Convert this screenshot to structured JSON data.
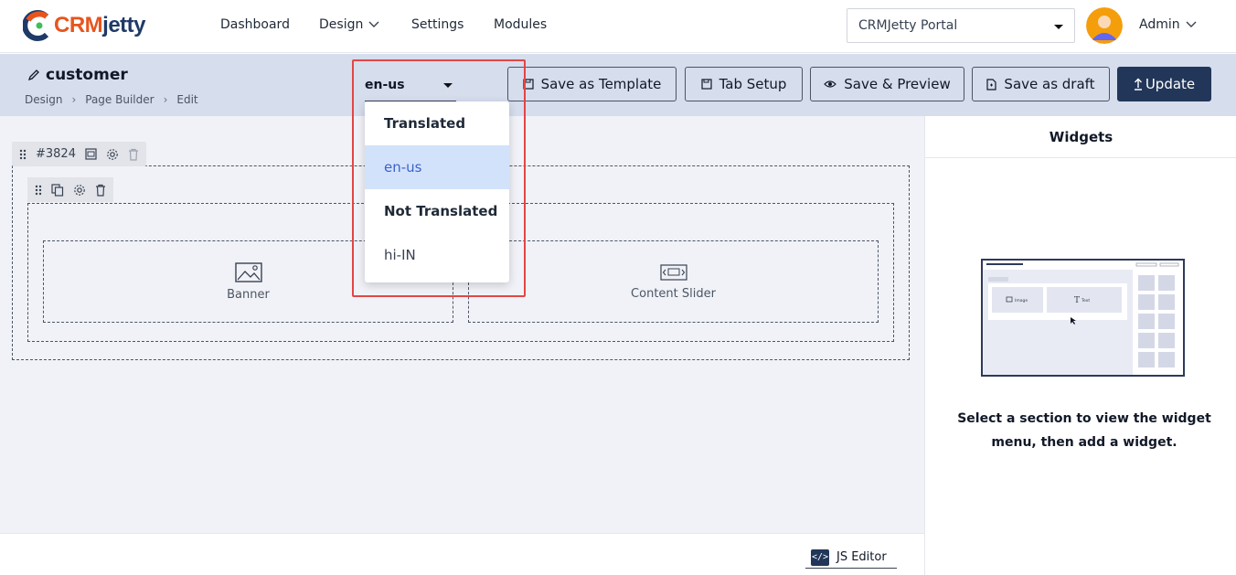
{
  "nav": {
    "logo_crm": "CRM",
    "logo_jetty": "jetty",
    "items": [
      {
        "label": "Dashboard"
      },
      {
        "label": "Design"
      },
      {
        "label": "Settings"
      },
      {
        "label": "Modules"
      }
    ],
    "portal_select": "CRMJetty Portal",
    "user": "Admin"
  },
  "header": {
    "title": "customer",
    "breadcrumb": [
      "Design",
      "Page Builder",
      "Edit"
    ],
    "language": "en-us",
    "buttons": {
      "save_template": "Save as Template",
      "tab_setup": "Tab Setup",
      "save_preview": "Save & Preview",
      "save_draft": "Save as draft",
      "update": "Update"
    }
  },
  "dropdown": {
    "items": [
      {
        "label": "Translated",
        "type": "group"
      },
      {
        "label": "en-us",
        "type": "option",
        "selected": true
      },
      {
        "label": "Not Translated",
        "type": "group"
      },
      {
        "label": "hi-IN",
        "type": "option"
      }
    ]
  },
  "canvas": {
    "section_id": "#3824",
    "columns": [
      {
        "label": "Banner",
        "icon": "image-icon"
      },
      {
        "label": "Content Slider",
        "icon": "slider-icon"
      }
    ]
  },
  "footer": {
    "js_editor": "JS Editor"
  },
  "widgets": {
    "title": "Widgets",
    "hint": "Select a section to view the widget menu, then add a widget.",
    "illus_image_label": "Image",
    "illus_text_label": "Text"
  },
  "colors": {
    "brand_orange": "#e8541e",
    "brand_navy": "#1f3a68",
    "primary_button": "#223659",
    "header_bg": "#d6dded",
    "highlight": "#e24646",
    "selected_bg": "#d3e2fb"
  }
}
